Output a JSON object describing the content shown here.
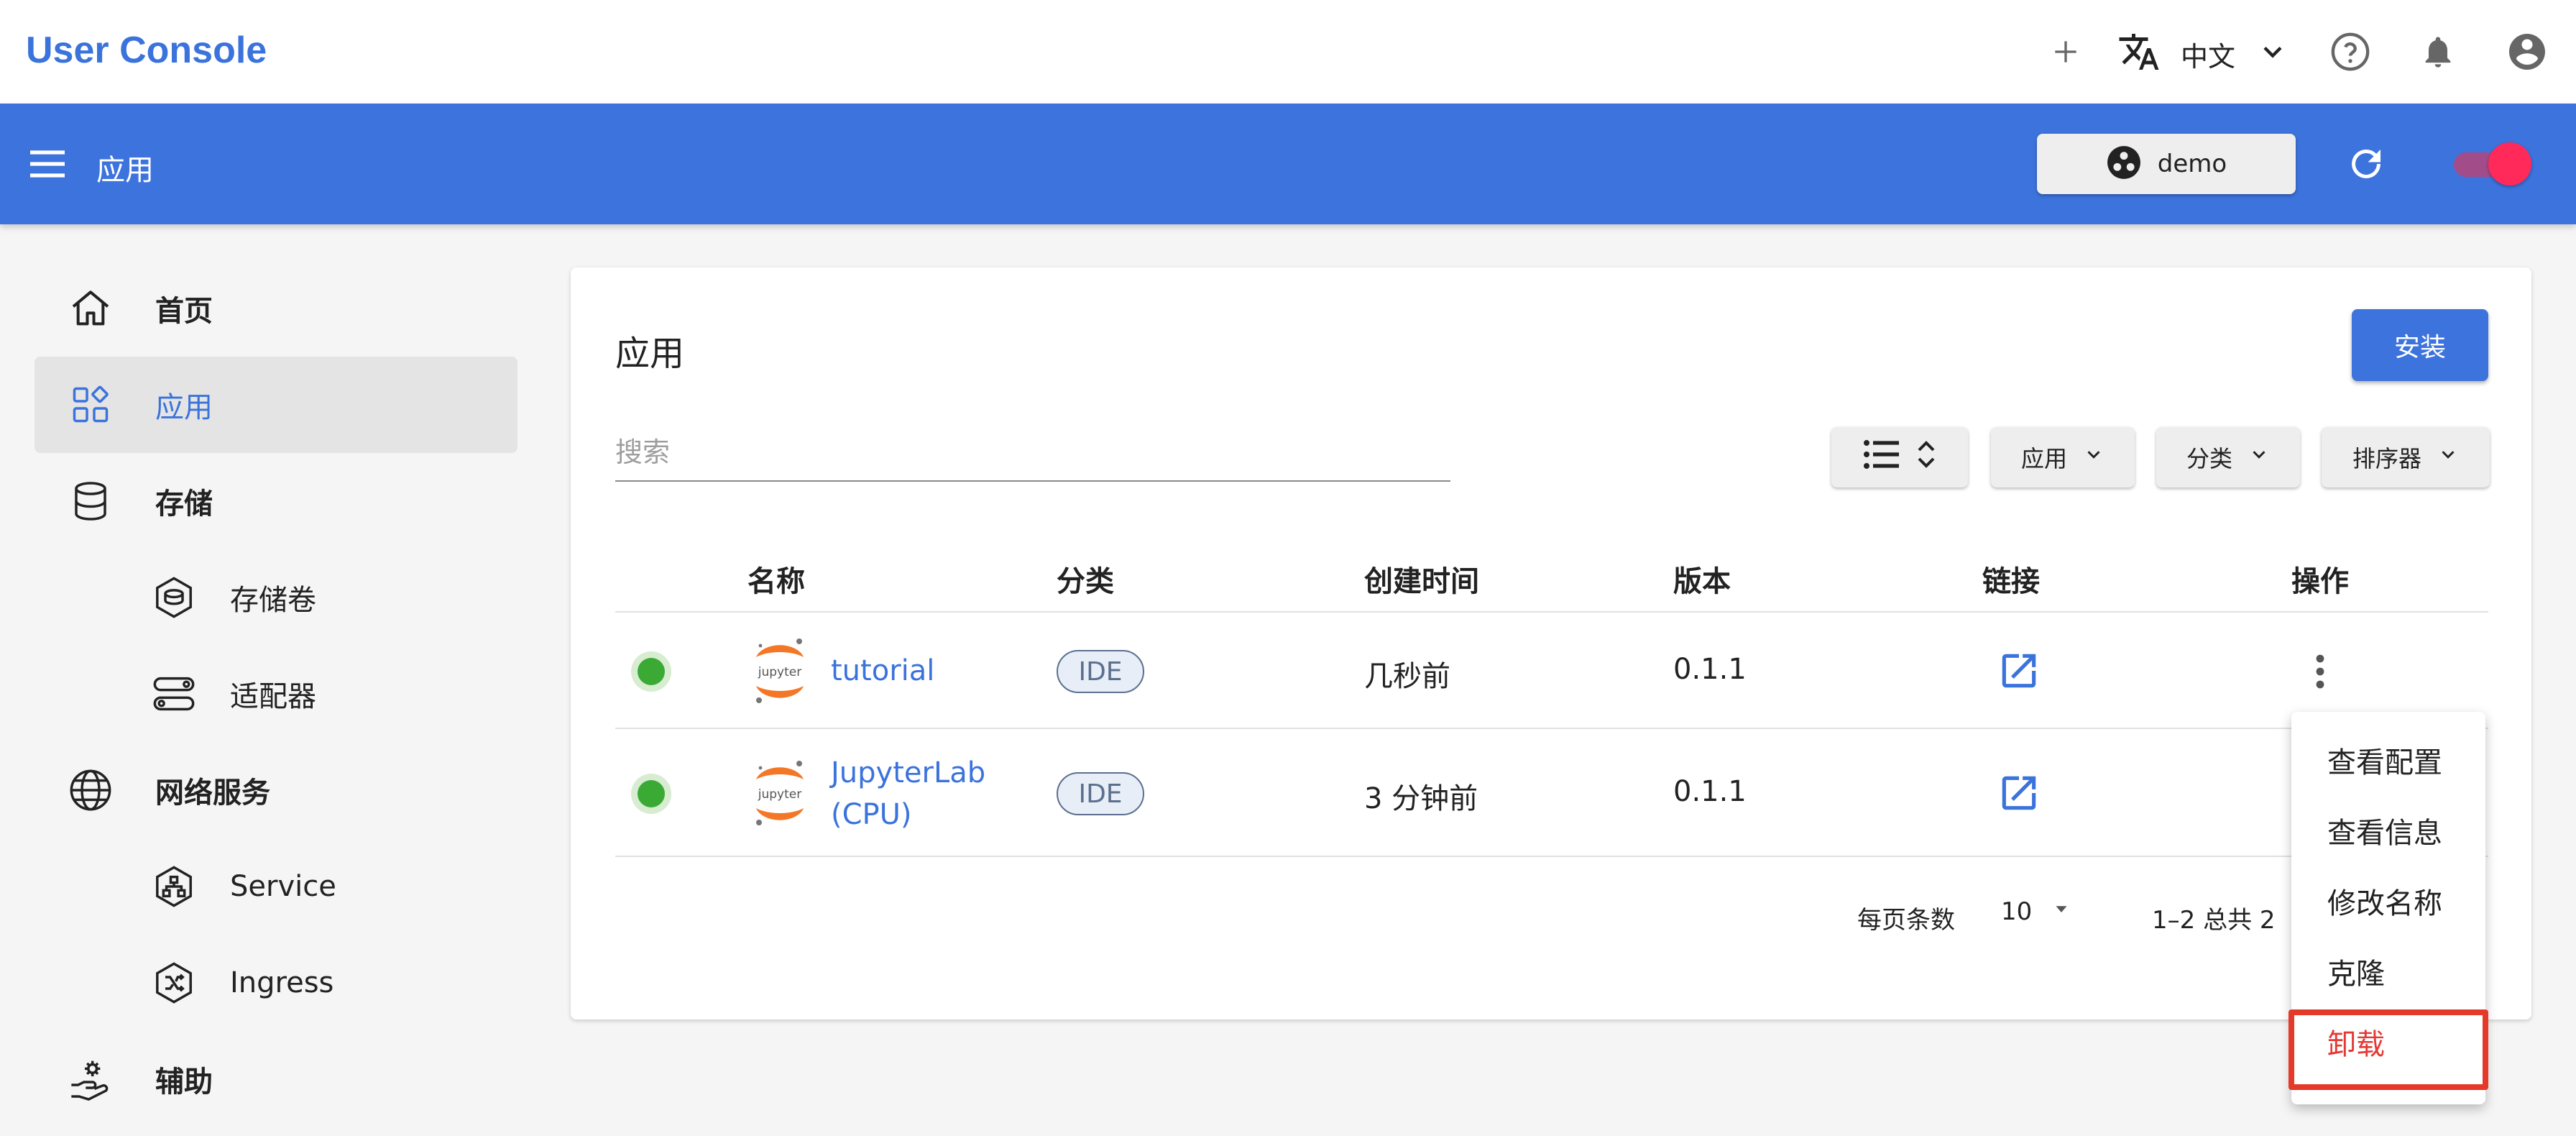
{
  "header": {
    "brand": "User Console",
    "language": "中文"
  },
  "appbar": {
    "title": "应用",
    "namespace": "demo"
  },
  "sidebar": {
    "items": [
      {
        "label": "首页",
        "icon": "home-icon"
      },
      {
        "label": "应用",
        "icon": "apps-icon",
        "active": true
      },
      {
        "label": "存储",
        "icon": "database-icon"
      },
      {
        "label": "存储卷",
        "icon": "volume-icon"
      },
      {
        "label": "适配器",
        "icon": "adapter-icon"
      },
      {
        "label": "网络服务",
        "icon": "globe-icon"
      },
      {
        "label": "Service",
        "icon": "service-icon"
      },
      {
        "label": "Ingress",
        "icon": "ingress-icon"
      },
      {
        "label": "辅助",
        "icon": "helper-icon"
      }
    ]
  },
  "main": {
    "title": "应用",
    "install_label": "安装",
    "search_placeholder": "搜索",
    "filters": {
      "app": "应用",
      "category": "分类",
      "sorter": "排序器"
    },
    "columns": [
      "名称",
      "分类",
      "创建时间",
      "版本",
      "链接",
      "操作"
    ],
    "rows": [
      {
        "logo_text": "jupyter",
        "name": "tutorial",
        "name_line2": "",
        "category": "IDE",
        "created": "几秒前",
        "version": "0.1.1"
      },
      {
        "logo_text": "jupyter",
        "name": "JupyterLab",
        "name_line2": "(CPU)",
        "category": "IDE",
        "created": "3 分钟前",
        "version": "0.1.1"
      }
    ],
    "pagination": {
      "per_page_label": "每页条数",
      "per_page": "10",
      "range": "1–2 总共 2"
    }
  },
  "menu": {
    "items": [
      "查看配置",
      "查看信息",
      "修改名称",
      "克隆",
      "卸载"
    ]
  },
  "colors": {
    "primary": "#3d73dd",
    "danger": "#e53935",
    "status_running": "#3aaa35"
  }
}
